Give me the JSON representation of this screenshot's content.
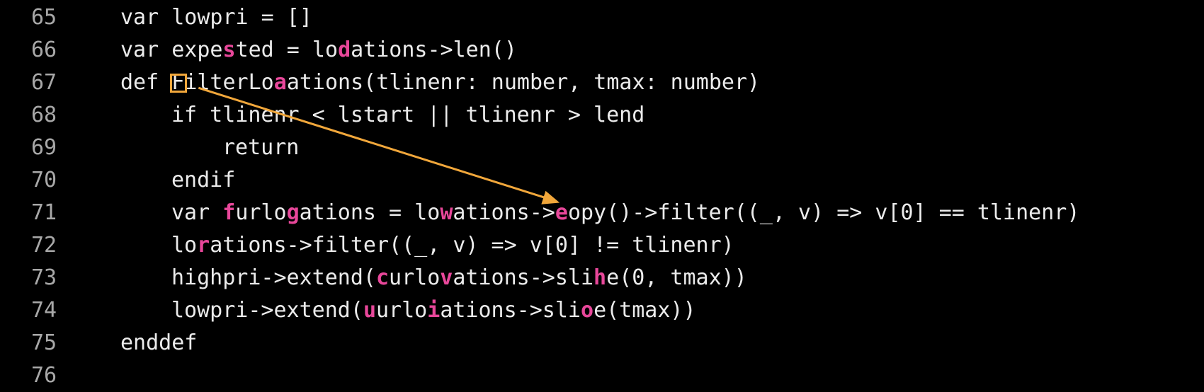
{
  "editor": {
    "highlight_color": "#e8479a",
    "cursor_color": "#f1a73b",
    "background": "#000000",
    "lines": [
      {
        "num": "65",
        "indent": 0,
        "segments": [
          {
            "t": "var lowpri = []"
          }
        ]
      },
      {
        "num": "66",
        "indent": 0,
        "segments": [
          {
            "t": "var expe"
          },
          {
            "t": "s",
            "hl": true
          },
          {
            "t": "ted = lo"
          },
          {
            "t": "d",
            "hl": true
          },
          {
            "t": "ations->len()"
          }
        ]
      },
      {
        "num": "67",
        "indent": 0,
        "segments": [
          {
            "t": "def "
          },
          {
            "t": "F",
            "cursor": true
          },
          {
            "t": "ilterLo"
          },
          {
            "t": "a",
            "hl": true
          },
          {
            "t": "ations(tlinenr: number, tmax: number)"
          }
        ]
      },
      {
        "num": "68",
        "indent": 1,
        "segments": [
          {
            "t": "if tlinenr < lstart || tlinenr > lend"
          }
        ]
      },
      {
        "num": "69",
        "indent": 2,
        "segments": [
          {
            "t": "return"
          }
        ]
      },
      {
        "num": "70",
        "indent": 1,
        "segments": [
          {
            "t": "endif"
          }
        ]
      },
      {
        "num": "71",
        "indent": 1,
        "segments": [
          {
            "t": "var "
          },
          {
            "t": "f",
            "hl": true
          },
          {
            "t": "urlo"
          },
          {
            "t": "g",
            "hl": true
          },
          {
            "t": "ations = lo"
          },
          {
            "t": "w",
            "hl": true
          },
          {
            "t": "ations->"
          },
          {
            "t": "e",
            "hl": true,
            "target": true
          },
          {
            "t": "opy()->filter((_, v) => v[0] == tlinenr)"
          }
        ]
      },
      {
        "num": "72",
        "indent": 1,
        "segments": [
          {
            "t": "lo"
          },
          {
            "t": "r",
            "hl": true
          },
          {
            "t": "ations->filter((_, v) => v[0] != tlinenr)"
          }
        ]
      },
      {
        "num": "73",
        "indent": 1,
        "segments": [
          {
            "t": "highpri->extend("
          },
          {
            "t": "c",
            "hl": true
          },
          {
            "t": "urlo"
          },
          {
            "t": "v",
            "hl": true
          },
          {
            "t": "ations->sli"
          },
          {
            "t": "h",
            "hl": true
          },
          {
            "t": "e(0, tmax))"
          }
        ]
      },
      {
        "num": "74",
        "indent": 1,
        "segments": [
          {
            "t": "lowpri->extend("
          },
          {
            "t": "u",
            "hl": true
          },
          {
            "t": "urlo"
          },
          {
            "t": "i",
            "hl": true
          },
          {
            "t": "ations->sli"
          },
          {
            "t": "o",
            "hl": true
          },
          {
            "t": "e(tmax))"
          }
        ]
      },
      {
        "num": "75",
        "indent": 0,
        "segments": [
          {
            "t": "enddef"
          }
        ]
      },
      {
        "num": "76",
        "indent": 0,
        "segments": []
      }
    ]
  }
}
